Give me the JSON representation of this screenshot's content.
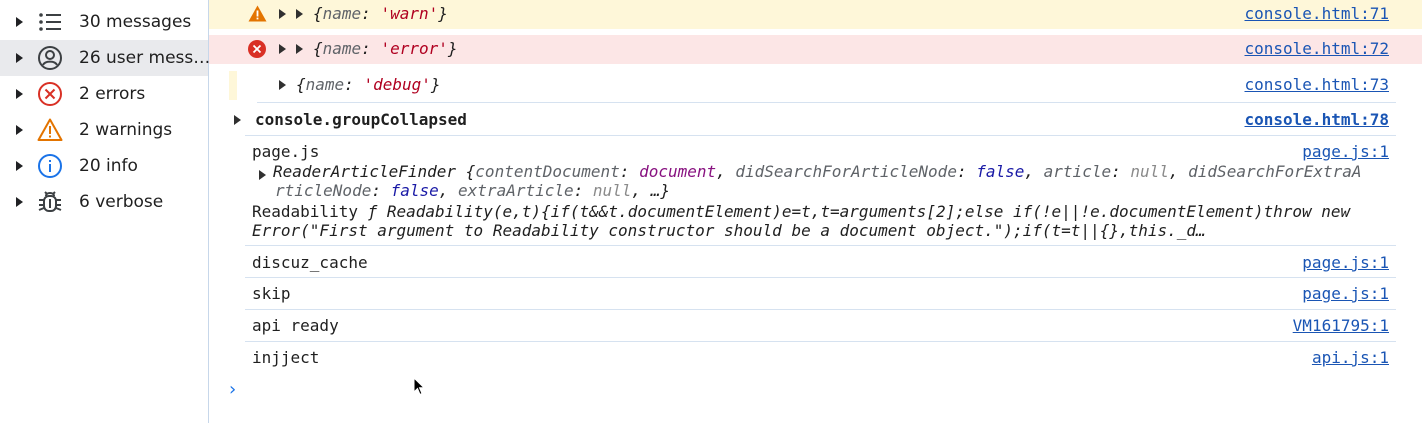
{
  "sidebar": {
    "items": [
      {
        "label": "30 messages",
        "icon": "list-icon"
      },
      {
        "label": "26 user mess…",
        "icon": "user-icon"
      },
      {
        "label": "2 errors",
        "icon": "error-icon"
      },
      {
        "label": "2 warnings",
        "icon": "warning-icon"
      },
      {
        "label": "20 info",
        "icon": "info-icon"
      },
      {
        "label": "6 verbose",
        "icon": "bug-icon"
      }
    ]
  },
  "console": {
    "warn_row": {
      "obj_open": "{",
      "key": "name",
      "colon": ": ",
      "value": "'warn'",
      "obj_close": "}",
      "source": "console.html:71"
    },
    "error_row": {
      "obj_open": "{",
      "key": "name",
      "colon": ": ",
      "value": "'error'",
      "obj_close": "}",
      "source": "console.html:72"
    },
    "debug_row": {
      "obj_open": "{",
      "key": "name",
      "colon": ": ",
      "value": "'debug'",
      "obj_close": "}",
      "source": "console.html:73"
    },
    "group_row": {
      "label": "console.groupCollapsed",
      "source": "console.html:78"
    },
    "pagejs_row": {
      "text": "page.js",
      "source": "page.js:1",
      "finder_name": "ReaderArticleFinder",
      "finder_line1_parts": [
        {
          "t": " {",
          "c": "p"
        },
        {
          "t": "contentDocument",
          "c": "k"
        },
        {
          "t": ": ",
          "c": "p"
        },
        {
          "t": "document",
          "c": "kv"
        },
        {
          "t": ", ",
          "c": "p"
        },
        {
          "t": "didSearchForArticleNode",
          "c": "k"
        },
        {
          "t": ": ",
          "c": "p"
        },
        {
          "t": "false",
          "c": "kw"
        },
        {
          "t": ", ",
          "c": "p"
        },
        {
          "t": "article",
          "c": "k"
        },
        {
          "t": ": ",
          "c": "p"
        },
        {
          "t": "null",
          "c": "nul"
        },
        {
          "t": ", ",
          "c": "p"
        },
        {
          "t": "didSearchForExtraA",
          "c": "k"
        }
      ],
      "finder_line2_parts": [
        {
          "t": "rticleNode",
          "c": "k"
        },
        {
          "t": ": ",
          "c": "p"
        },
        {
          "t": "false",
          "c": "kw"
        },
        {
          "t": ", ",
          "c": "p"
        },
        {
          "t": "extraArticle",
          "c": "k"
        },
        {
          "t": ": ",
          "c": "p"
        },
        {
          "t": "null",
          "c": "nul"
        },
        {
          "t": ", …}",
          "c": "p"
        }
      ],
      "readability_label": "Readability",
      "readability_line1": "ƒ Readability(e,t){if(t&&t.documentElement)e=t,t=arguments[2];else if(!e||!e.documentElement)throw new",
      "readability_line2": "Error(\"First argument to Readability constructor should be a document object.\");if(t=t||{},this._d…"
    },
    "log_rows": [
      {
        "text": "discuz_cache",
        "source": "page.js:1"
      },
      {
        "text": "skip",
        "source": "page.js:1"
      },
      {
        "text": "api ready",
        "source": "VM161795:1"
      },
      {
        "text": "injject",
        "source": "api.js:1"
      }
    ],
    "prompt": "›"
  },
  "colors": {
    "warn_bg": "#fef7d9",
    "error_bg": "#fce6e6",
    "link": "#1a55b4",
    "selected_bg": "#e9eaed"
  }
}
